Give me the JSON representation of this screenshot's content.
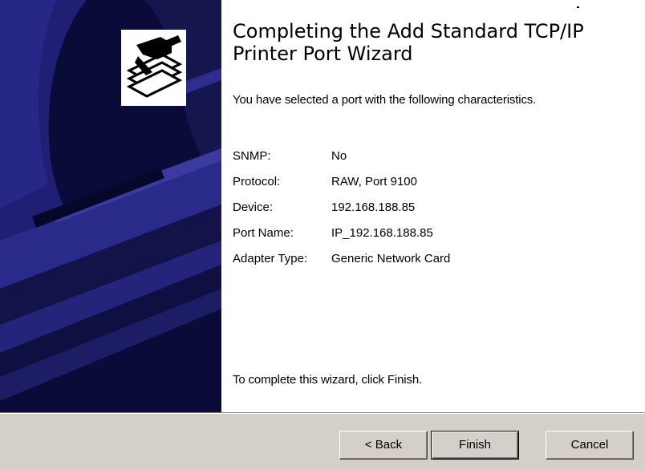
{
  "wizard": {
    "title": "Completing the Add Standard TCP/IP Printer Port Wizard",
    "intro": "You have selected a port with the following characteristics.",
    "details": [
      {
        "label": "SNMP:",
        "value": "No"
      },
      {
        "label": "Protocol:",
        "value": "RAW, Port 9100"
      },
      {
        "label": "Device:",
        "value": "192.168.188.85"
      },
      {
        "label": "Port Name:",
        "value": "IP_192.168.188.85"
      },
      {
        "label": "Adapter Type:",
        "value": "Generic Network Card"
      }
    ],
    "outro": "To complete this wizard, click Finish."
  },
  "buttons": {
    "back_label": "< Back",
    "finish_label": "Finish",
    "cancel_label": "Cancel"
  },
  "icons": {
    "sidebar_art": "printer-watermark-icon",
    "wizard_icon": "printer-port-icon"
  },
  "colors": {
    "sidebar_dark": "#0c0c3c",
    "sidebar_light": "#2c2c8c",
    "sidebar_mid": "#1c1c6e",
    "button_face": "#d4d0c8"
  }
}
